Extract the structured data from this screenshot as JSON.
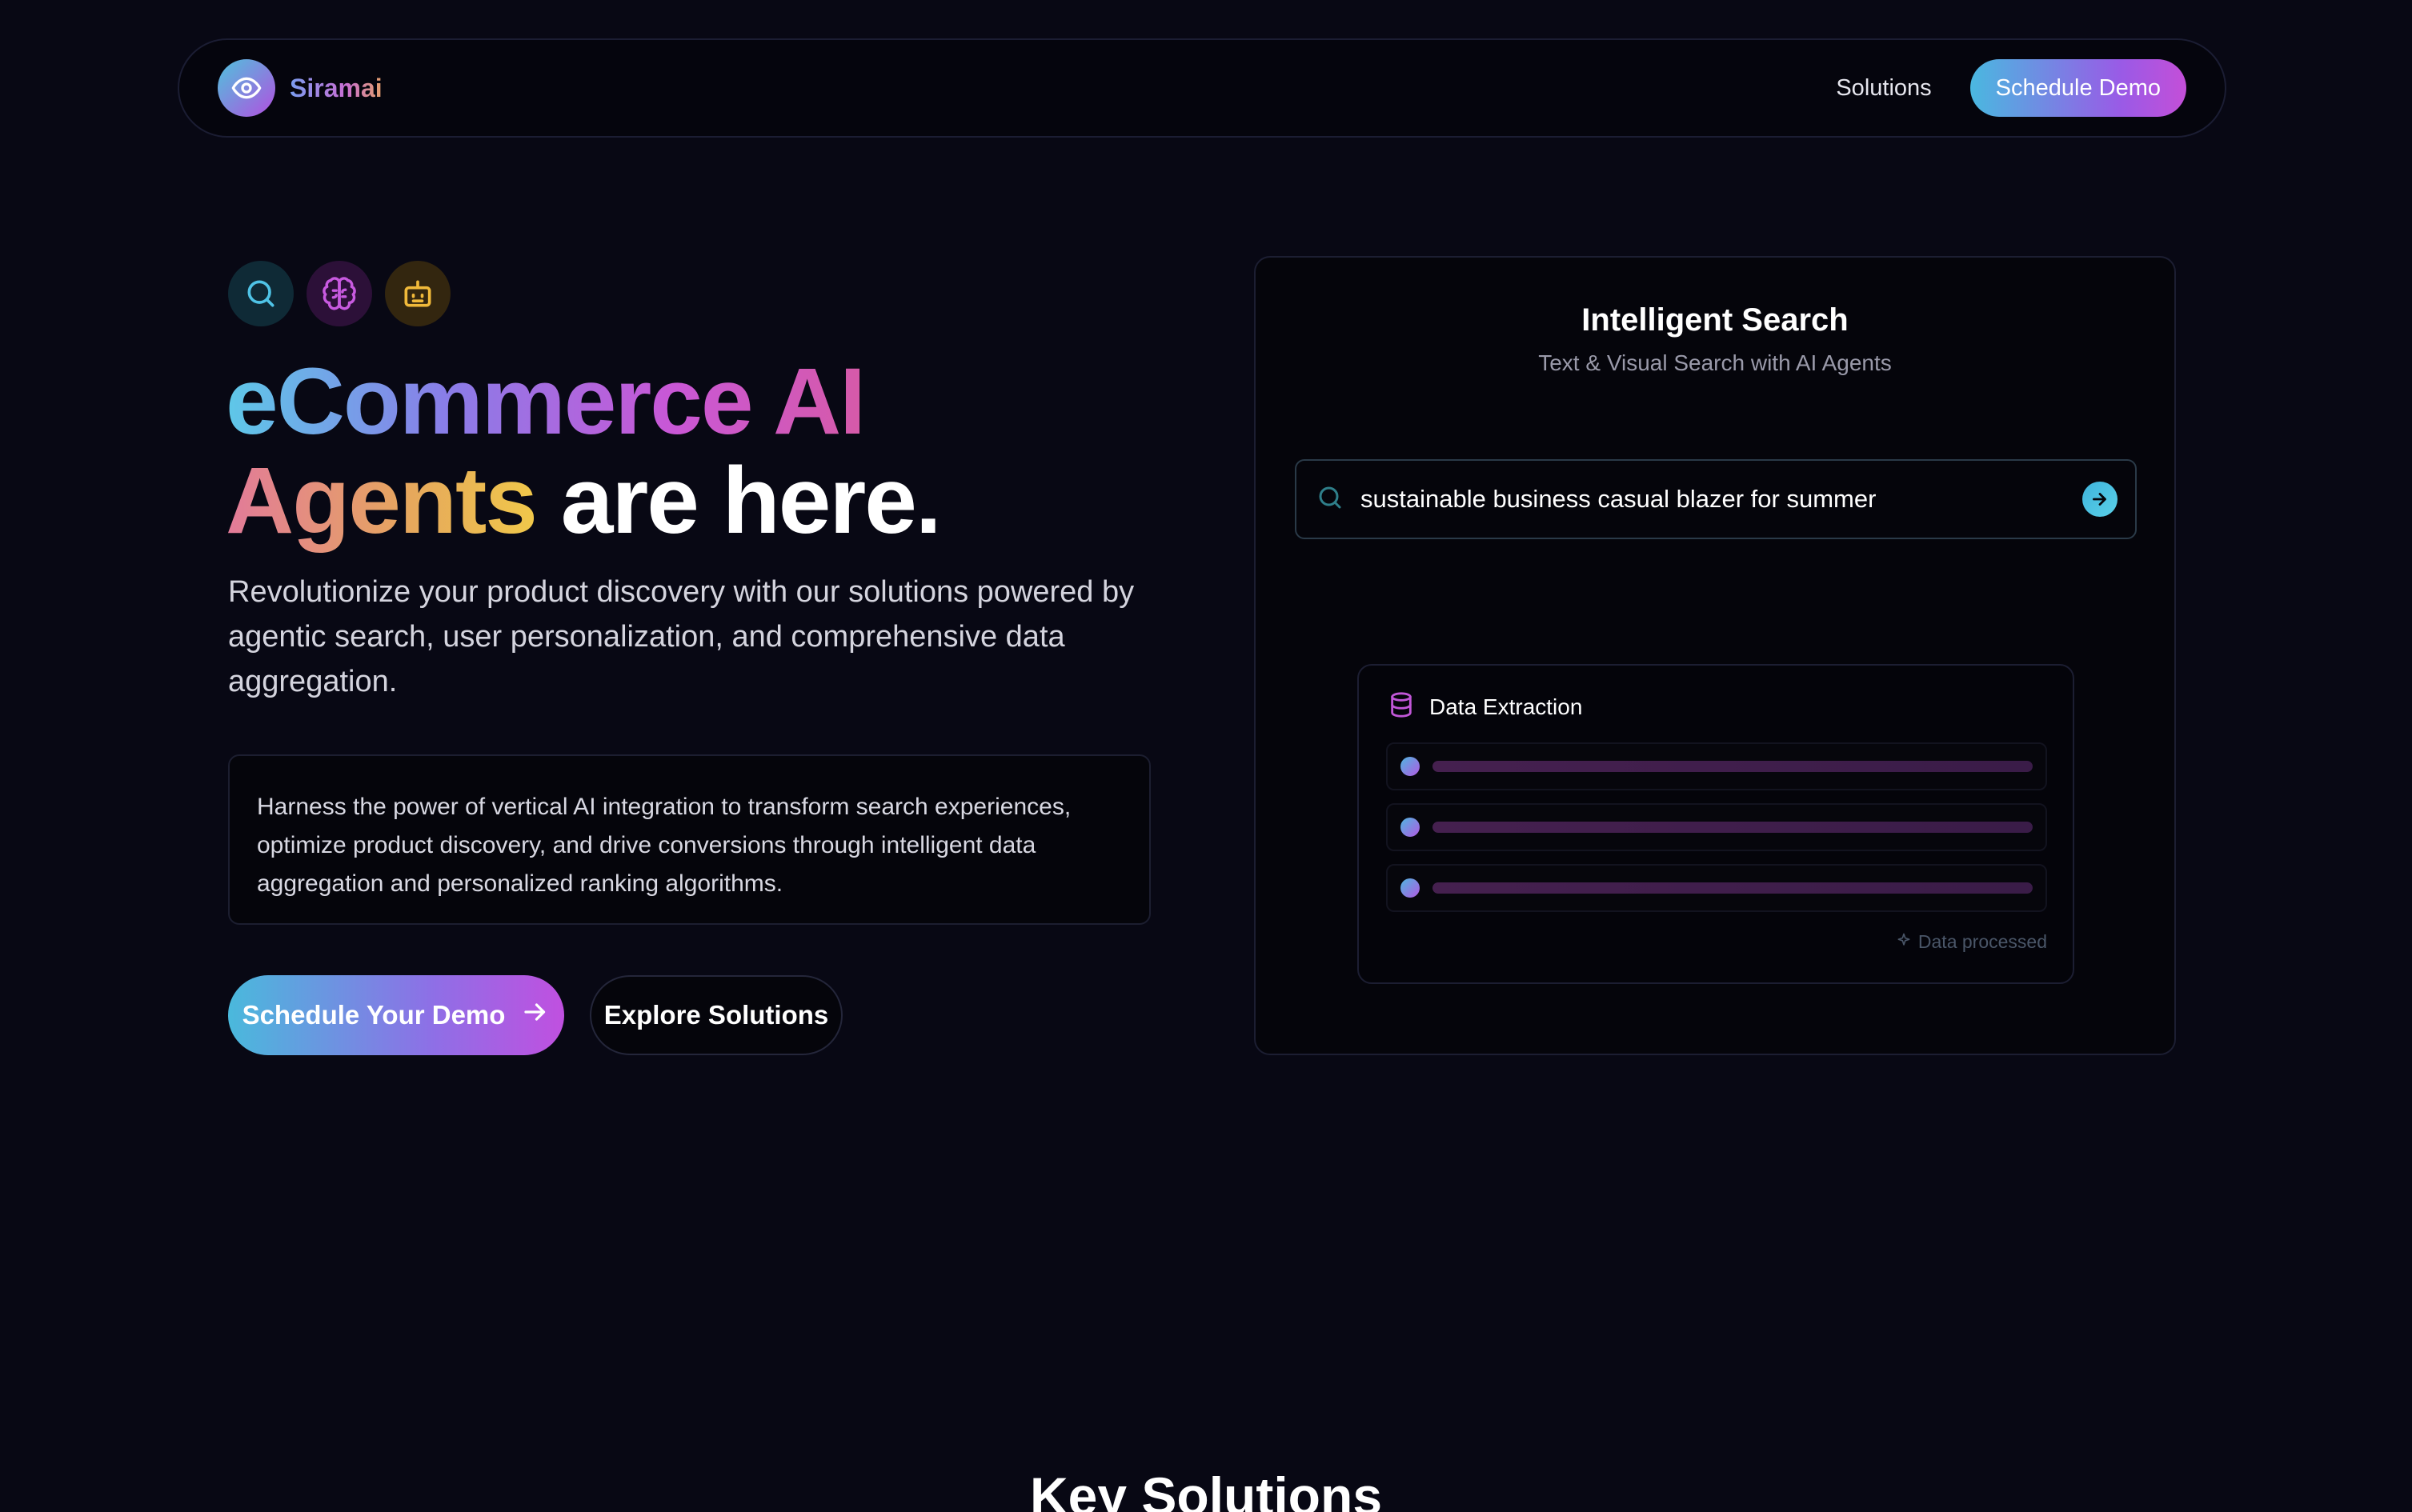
{
  "nav": {
    "brand": "Siramai",
    "links": [
      {
        "label": "Solutions"
      }
    ],
    "cta": "Schedule Demo"
  },
  "hero": {
    "icons": [
      "search-icon",
      "brain-icon",
      "bot-icon"
    ],
    "headline": {
      "part1": "eCommerce AI",
      "part2": "Agents",
      "part3": " are here."
    },
    "subhead": "Revolutionize your product discovery with our solutions powered by agentic search, user personalization, and comprehensive data aggregation.",
    "callout": "Harness the power of vertical AI integration to transform search experiences, optimize product discovery, and drive conversions through intelligent data aggregation and personalized ranking algorithms.",
    "primary_cta": "Schedule Your Demo",
    "secondary_cta": "Explore Solutions"
  },
  "demo": {
    "title": "Intelligent Search",
    "subtitle": "Text & Visual Search with AI Agents",
    "search_query": "sustainable business casual blazer for summer",
    "extraction": {
      "title": "Data Extraction",
      "rows": [
        {
          "progress": 1.0
        },
        {
          "progress": 1.0
        },
        {
          "progress": 1.0
        }
      ],
      "status": "Data processed"
    }
  },
  "sections": {
    "key_solutions": "Key Solutions"
  },
  "colors": {
    "background": "#080814",
    "accent_cyan": "#4ab9dc",
    "accent_purple": "#c050e0",
    "accent_gold": "#f0c84a"
  }
}
